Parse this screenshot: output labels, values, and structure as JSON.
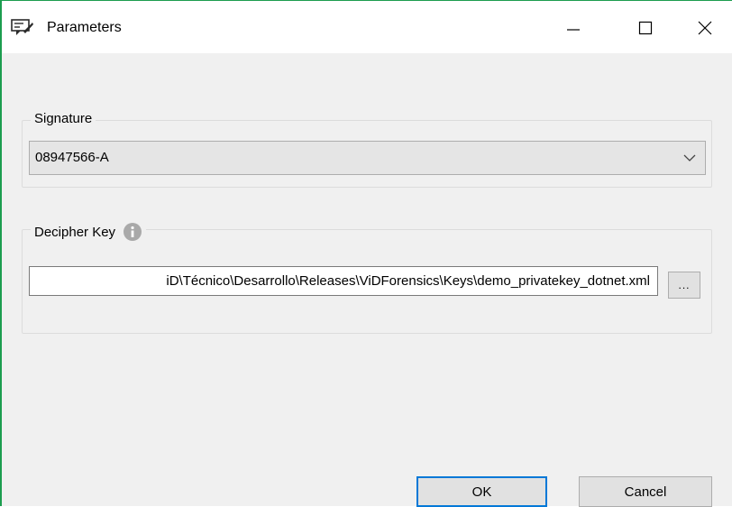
{
  "window": {
    "title": "Parameters",
    "icon": "parameters-window-icon",
    "controls": {
      "minimize": "minimize-icon",
      "maximize": "maximize-icon",
      "close": "close-icon"
    },
    "accent_border": "#1c9d4f"
  },
  "signature": {
    "group_label": "Signature",
    "selected_value": "08947566-A"
  },
  "decipher_key": {
    "group_label": "Decipher Key",
    "info_icon": "info-icon",
    "path_value": "iD\\Técnico\\Desarrollo\\Releases\\ViDForensics\\Keys\\demo_privatekey_dotnet.xml",
    "browse_label": "..."
  },
  "buttons": {
    "ok_label": "OK",
    "cancel_label": "Cancel",
    "default_border": "#0078d7"
  }
}
